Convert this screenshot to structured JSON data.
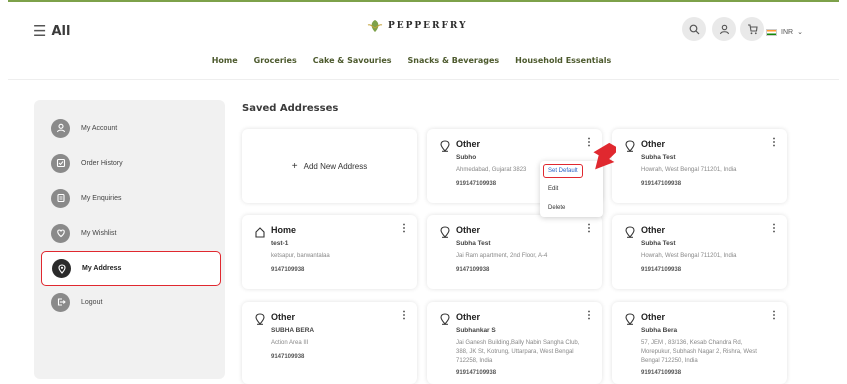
{
  "header": {
    "menu_label": "All",
    "logo_text": "PEPPERFRY",
    "currency": "INR"
  },
  "nav": [
    "Home",
    "Groceries",
    "Cake & Savouries",
    "Snacks & Beverages",
    "Household Essentials"
  ],
  "sidebar": {
    "items": [
      {
        "label": "My Account",
        "icon": "user-icon"
      },
      {
        "label": "Order History",
        "icon": "order-icon"
      },
      {
        "label": "My Enquiries",
        "icon": "enquiry-icon"
      },
      {
        "label": "My Wishlist",
        "icon": "heart-icon"
      },
      {
        "label": "My Address",
        "icon": "location-icon",
        "active": true
      },
      {
        "label": "Logout",
        "icon": "logout-icon"
      }
    ]
  },
  "main": {
    "title": "Saved Addresses",
    "add_label": "Add New Address",
    "addresses": [
      {
        "type": "Other",
        "name": "Subho",
        "address": "Ahmedabad, Gujarat 3823",
        "phone": "919147109938"
      },
      {
        "type": "Other",
        "name": "Subha Test",
        "address": "Howrah, West Bengal 711201, India",
        "phone": "919147109938"
      },
      {
        "type": "Home",
        "name": "test-1",
        "address": "ketsapur, barwantalaa",
        "phone": "9147109938"
      },
      {
        "type": "Other",
        "name": "Subha Test",
        "address": "Jai Ram apartment, 2nd Floor, A-4",
        "phone": "9147109938"
      },
      {
        "type": "Other",
        "name": "Subha Test",
        "address": "Howrah, West Bengal 711201, India",
        "phone": "919147109938"
      },
      {
        "type": "Other",
        "name": "SUBHA BERA",
        "address": "Action Area III",
        "phone": "9147109938"
      },
      {
        "type": "Other",
        "name": "Subhankar S",
        "address": "Jai Ganesh Building,Bally Nabin Sangha Club, 388, JK St, Kotrung, Uttarpara, West Bengal 712258, India",
        "phone": "919147109938"
      },
      {
        "type": "Other",
        "name": "Subha Bera",
        "address": "57, JEM , 83/136, Kesab Chandra Rd, Morepukur, Subhash Nagar 2, Rishra, West Bengal 712250, India",
        "phone": "919147109938"
      }
    ],
    "dropdown": [
      "Set Default",
      "Edit",
      "Delete"
    ]
  },
  "colors": {
    "accent": "#e0282f",
    "brand": "#7da14a",
    "nav_text": "#4d5a2e"
  }
}
